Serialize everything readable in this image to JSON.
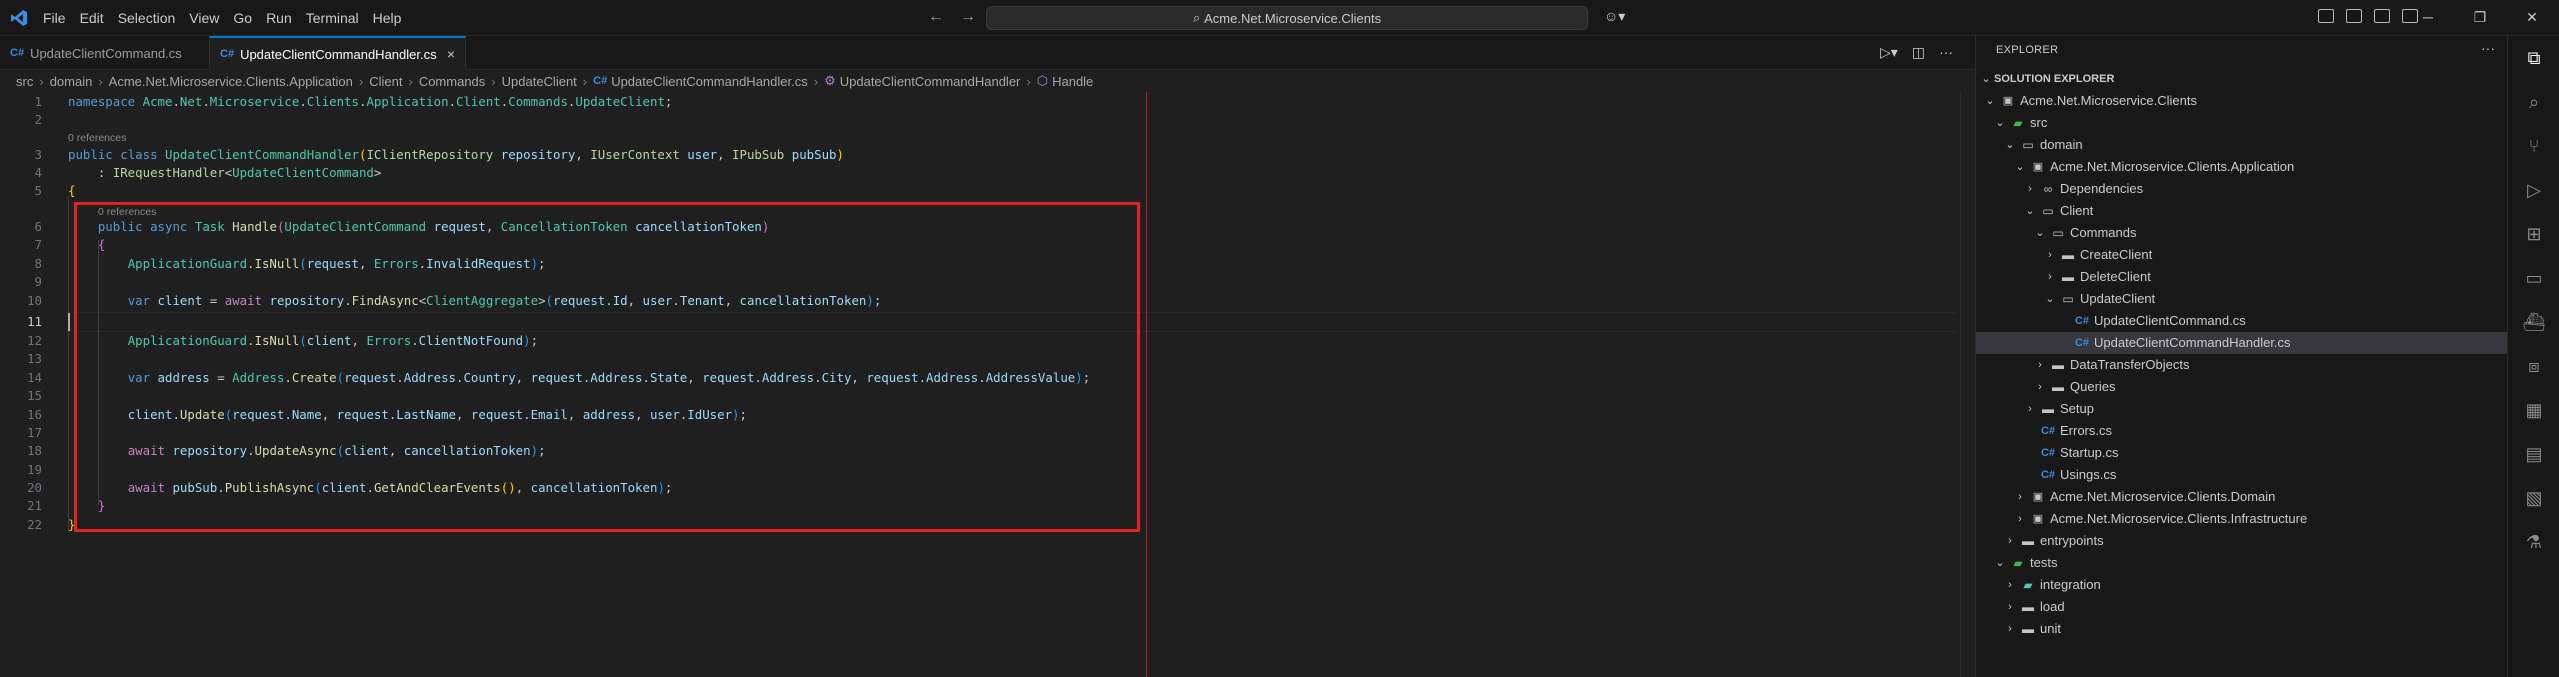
{
  "menu": [
    "File",
    "Edit",
    "Selection",
    "View",
    "Go",
    "Run",
    "Terminal",
    "Help"
  ],
  "search": {
    "text": "Acme.Net.Microservice.Clients"
  },
  "tabs": [
    {
      "label": "UpdateClientCommand.cs"
    },
    {
      "label": "UpdateClientCommandHandler.cs",
      "close": "×"
    }
  ],
  "breadcrumb": [
    "src",
    "domain",
    "Acme.Net.Microservice.Clients.Application",
    "Client",
    "Commands",
    "UpdateClient",
    "UpdateClientCommandHandler.cs",
    "UpdateClientCommandHandler",
    "Handle"
  ],
  "editor": {
    "line_numbers": [
      "1",
      "2",
      "3",
      "4",
      "5",
      "6",
      "7",
      "8",
      "9",
      "10",
      "11",
      "12",
      "13",
      "14",
      "15",
      "16",
      "17",
      "18",
      "19",
      "20",
      "21",
      "22"
    ],
    "current_line": "11",
    "codelens": [
      "0 references",
      "0 references"
    ]
  },
  "explorer": {
    "title": "EXPLORER",
    "more": "···",
    "tree": [
      {
        "label": "SOLUTION EXPLORER"
      },
      {
        "label": "Acme.Net.Microservice.Clients"
      },
      {
        "label": "src"
      },
      {
        "label": "domain"
      },
      {
        "label": "Acme.Net.Microservice.Clients.Application"
      },
      {
        "label": "Dependencies"
      },
      {
        "label": "Client"
      },
      {
        "label": "Commands"
      },
      {
        "label": "CreateClient"
      },
      {
        "label": "DeleteClient"
      },
      {
        "label": "UpdateClient"
      },
      {
        "label": "UpdateClientCommand.cs"
      },
      {
        "label": "UpdateClientCommandHandler.cs"
      },
      {
        "label": "DataTransferObjects"
      },
      {
        "label": "Queries"
      },
      {
        "label": "Setup"
      },
      {
        "label": "Errors.cs"
      },
      {
        "label": "Startup.cs"
      },
      {
        "label": "Usings.cs"
      },
      {
        "label": "Acme.Net.Microservice.Clients.Domain"
      },
      {
        "label": "Acme.Net.Microservice.Clients.Infrastructure"
      },
      {
        "label": "entrypoints"
      },
      {
        "label": "tests"
      },
      {
        "label": "integration"
      },
      {
        "label": "load"
      },
      {
        "label": "unit"
      }
    ]
  },
  "colors": {
    "accent": "#0078d4",
    "highlight_box": "#e02424",
    "ruler": "#b5202c",
    "background": "#1f1f1f"
  }
}
